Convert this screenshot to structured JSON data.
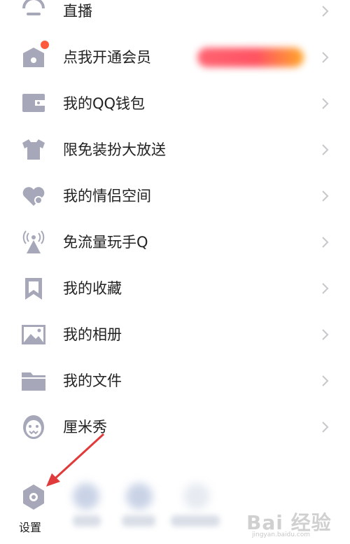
{
  "menu": {
    "items": [
      {
        "label": "直播",
        "icon": "live-icon"
      },
      {
        "label": "点我开通会员",
        "icon": "vip-crown-icon"
      },
      {
        "label": "我的QQ钱包",
        "icon": "wallet-icon"
      },
      {
        "label": "限免装扮大放送",
        "icon": "tshirt-icon"
      },
      {
        "label": "我的情侣空间",
        "icon": "couple-heart-icon"
      },
      {
        "label": "免流量玩手Q",
        "icon": "signal-tower-icon"
      },
      {
        "label": "我的收藏",
        "icon": "bookmark-icon"
      },
      {
        "label": "我的相册",
        "icon": "photo-album-icon"
      },
      {
        "label": "我的文件",
        "icon": "folder-icon"
      },
      {
        "label": "厘米秀",
        "icon": "cmshow-face-icon"
      }
    ]
  },
  "bottom": {
    "settings_label": "设置"
  },
  "watermark": {
    "main": "Bai 经验",
    "sub": "jingyan.baidu.com"
  },
  "colors": {
    "icon_gray": "#a6a8b9",
    "chevron": "#c7c7cc",
    "arrow_red": "#e03a3a",
    "vip_dot": "#ff5a3c"
  }
}
